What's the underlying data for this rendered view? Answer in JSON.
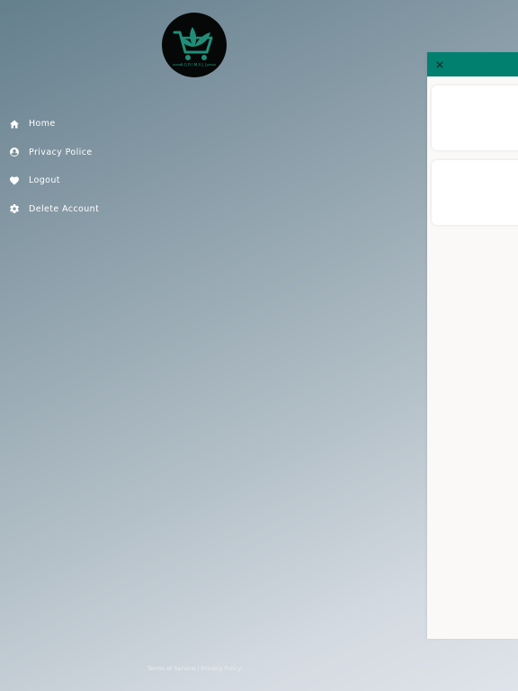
{
  "logo": {
    "icon": "shopping-cart-leaf-logo",
    "tagline": "AGRIMALL"
  },
  "colors": {
    "accent": "#01806f",
    "logo_green": "#1f8e78",
    "panel_bg": "#fbf9f8"
  },
  "menu": {
    "items": [
      {
        "label": "Home",
        "icon": "home-icon"
      },
      {
        "label": "Privacy Police",
        "icon": "user-circle-icon"
      },
      {
        "label": "Logout",
        "icon": "heart-icon"
      },
      {
        "label": "Delete Account",
        "icon": "gear-icon"
      }
    ]
  },
  "footer": {
    "terms": "Terms of Service",
    "separator": "|",
    "privacy": "Privacy Policy"
  },
  "panel": {
    "close_icon": "close-icon"
  }
}
